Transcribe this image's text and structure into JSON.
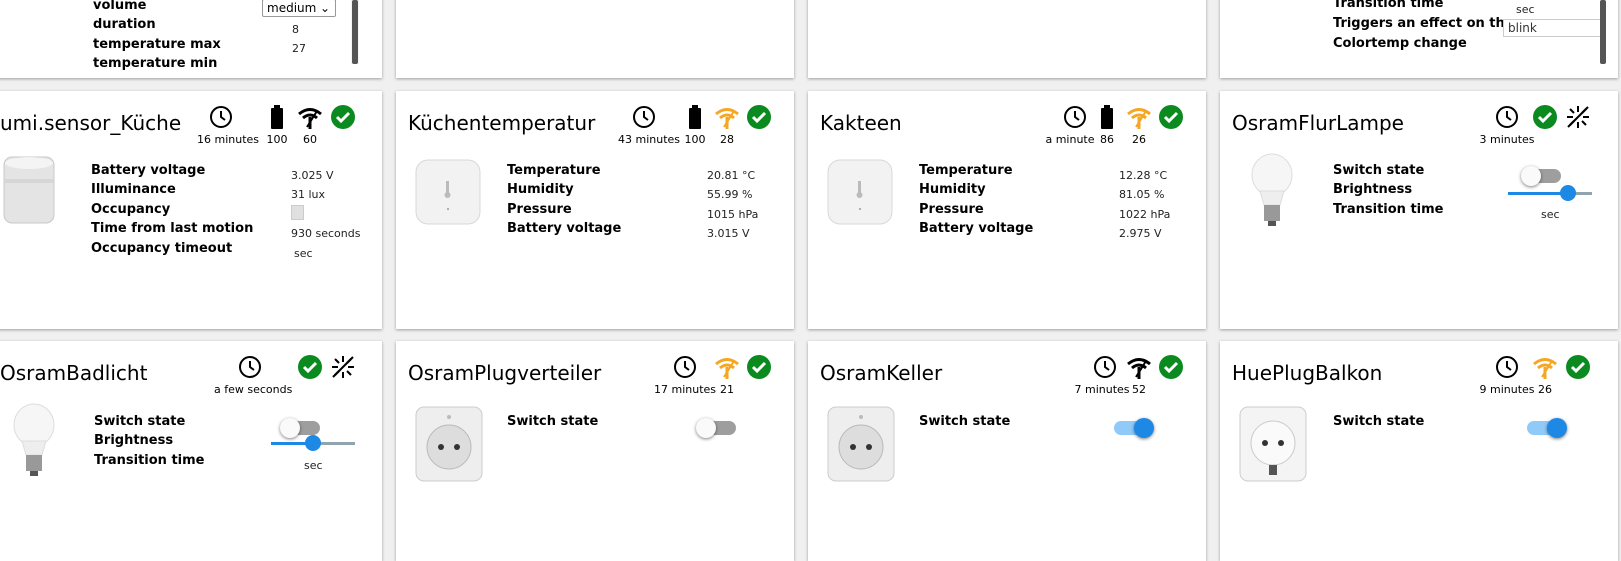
{
  "top_row": {
    "card1": {
      "rows": [
        {
          "label": "volume",
          "value": "medium"
        },
        {
          "label": "duration",
          "value": "8"
        },
        {
          "label": "temperature max",
          "value": "27"
        },
        {
          "label": "temperature min",
          "value": ""
        }
      ]
    },
    "card4": {
      "rows": [
        {
          "label": "Transition time",
          "value": "sec"
        },
        {
          "label": "Triggers an effect on the…",
          "value": "blink"
        },
        {
          "label": "Colortemp change",
          "value": ""
        }
      ]
    }
  },
  "cards": [
    {
      "title": "umi.sensor_Küche",
      "time": "16 minutes",
      "battery": "100",
      "signal": "60",
      "rows": [
        {
          "label": "Battery voltage",
          "value": "3.025 V"
        },
        {
          "label": "Illuminance",
          "value": "31 lux"
        },
        {
          "label": "Occupancy",
          "value": ""
        },
        {
          "label": "Time from last motion",
          "value": "930 seconds"
        },
        {
          "label": "Occupancy timeout",
          "value": "sec"
        }
      ]
    },
    {
      "title": "Küchentemperatur",
      "time": "43 minutes",
      "battery": "100",
      "signal": "28",
      "rows": [
        {
          "label": "Temperature",
          "value": "20.81 °C"
        },
        {
          "label": "Humidity",
          "value": "55.99 %"
        },
        {
          "label": "Pressure",
          "value": "1015 hPa"
        },
        {
          "label": "Battery voltage",
          "value": "3.015 V"
        }
      ]
    },
    {
      "title": "Kakteen",
      "time": "a minute",
      "battery": "86",
      "signal": "26",
      "rows": [
        {
          "label": "Temperature",
          "value": "12.28 °C"
        },
        {
          "label": "Humidity",
          "value": "81.05 %"
        },
        {
          "label": "Pressure",
          "value": "1022 hPa"
        },
        {
          "label": "Battery voltage",
          "value": "2.975 V"
        }
      ]
    },
    {
      "title": "OsramFlurLampe",
      "time": "3 minutes",
      "rows": [
        {
          "label": "Switch state"
        },
        {
          "label": "Brightness"
        },
        {
          "label": "Transition time",
          "value": "sec"
        }
      ],
      "switch_on": false,
      "brightness": 0.7
    },
    {
      "title": "OsramBadlicht",
      "time": "a few seconds",
      "rows": [
        {
          "label": "Switch state"
        },
        {
          "label": "Brightness"
        },
        {
          "label": "Transition time",
          "value": "sec"
        }
      ],
      "switch_on": false,
      "brightness": 0.5
    },
    {
      "title": "OsramPlugverteiler",
      "time": "17 minutes",
      "signal": "21",
      "rows": [
        {
          "label": "Switch state"
        }
      ],
      "switch_on": false
    },
    {
      "title": "OsramKeller",
      "time": "7 minutes",
      "signal": "52",
      "rows": [
        {
          "label": "Switch state"
        }
      ],
      "switch_on": true
    },
    {
      "title": "HuePlugBalkon",
      "time": "9 minutes",
      "signal": "26",
      "rows": [
        {
          "label": "Switch state"
        }
      ],
      "switch_on": true
    }
  ],
  "colors": {
    "ok_green": "#0b8a1f",
    "signal_weak": "#f5a623",
    "signal_good": "#000000",
    "toggle_on": "#1e88e5"
  }
}
